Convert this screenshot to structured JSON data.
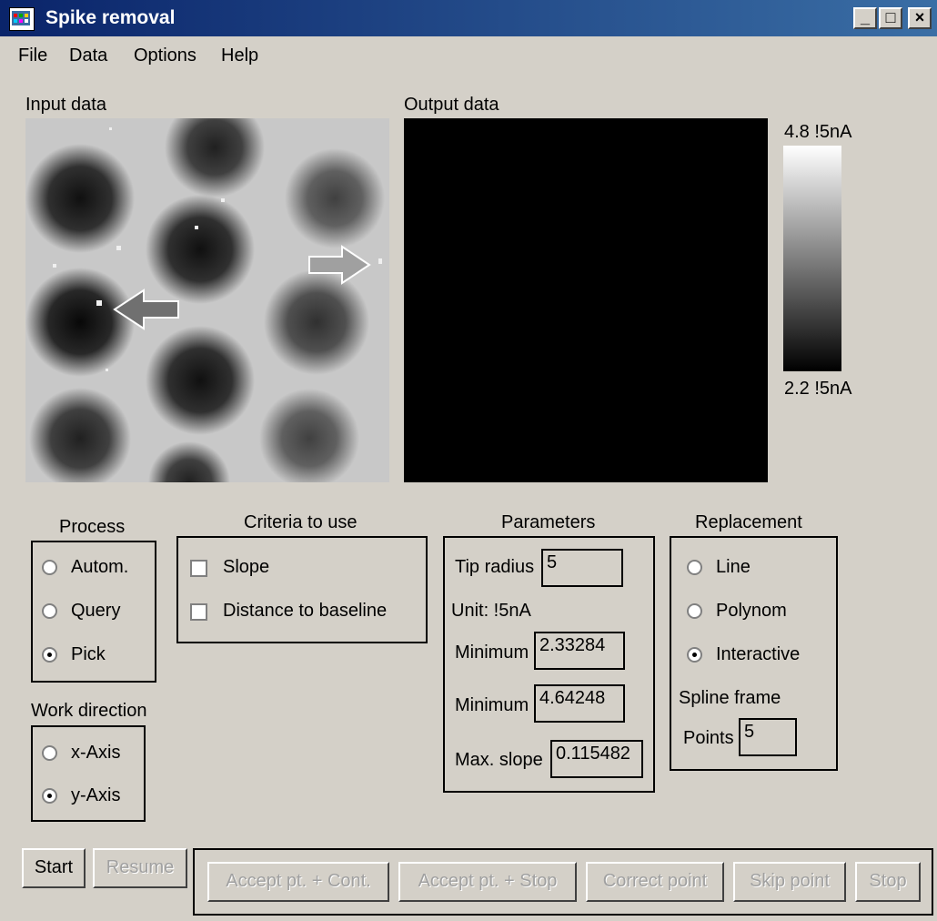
{
  "window": {
    "title": "Spike removal",
    "controls": [
      "_",
      "□",
      "×"
    ]
  },
  "menu": [
    "File",
    "Data",
    "Options",
    "Help"
  ],
  "panels": {
    "input_label": "Input data",
    "output_label": "Output data"
  },
  "colorbar": {
    "max_label": "4.8 !5nA",
    "min_label": "2.2 !5nA"
  },
  "process": {
    "title": "Process",
    "options": [
      {
        "label": "Autom.",
        "selected": false
      },
      {
        "label": "Query",
        "selected": false
      },
      {
        "label": "Pick",
        "selected": true
      }
    ]
  },
  "work_direction": {
    "title": "Work direction",
    "options": [
      {
        "label": "x-Axis",
        "selected": false
      },
      {
        "label": "y-Axis",
        "selected": true
      }
    ]
  },
  "criteria": {
    "title": "Criteria to use",
    "options": [
      {
        "label": "Slope",
        "checked": false
      },
      {
        "label": "Distance to baseline",
        "checked": false
      }
    ]
  },
  "parameters": {
    "title": "Parameters",
    "tip_radius_label": "Tip radius",
    "tip_radius_value": "5",
    "unit_label": "Unit: !5nA",
    "minimum1_label": "Minimum",
    "minimum1_value": "2.33284",
    "minimum2_label": "Minimum",
    "minimum2_value": "4.64248",
    "max_slope_label": "Max. slope",
    "max_slope_value": "0.115482"
  },
  "replacement": {
    "title": "Replacement",
    "options": [
      {
        "label": "Line",
        "selected": false
      },
      {
        "label": "Polynom",
        "selected": false
      },
      {
        "label": "Interactive",
        "selected": true
      }
    ],
    "spline_frame_label": "Spline frame",
    "points_label": "Points",
    "points_value": "5"
  },
  "buttons": {
    "start": "Start",
    "resume": "Resume",
    "accept_cont": "Accept pt. + Cont.",
    "accept_stop": "Accept pt. + Stop",
    "correct_point": "Correct point",
    "skip_point": "Skip point",
    "stop": "Stop"
  }
}
